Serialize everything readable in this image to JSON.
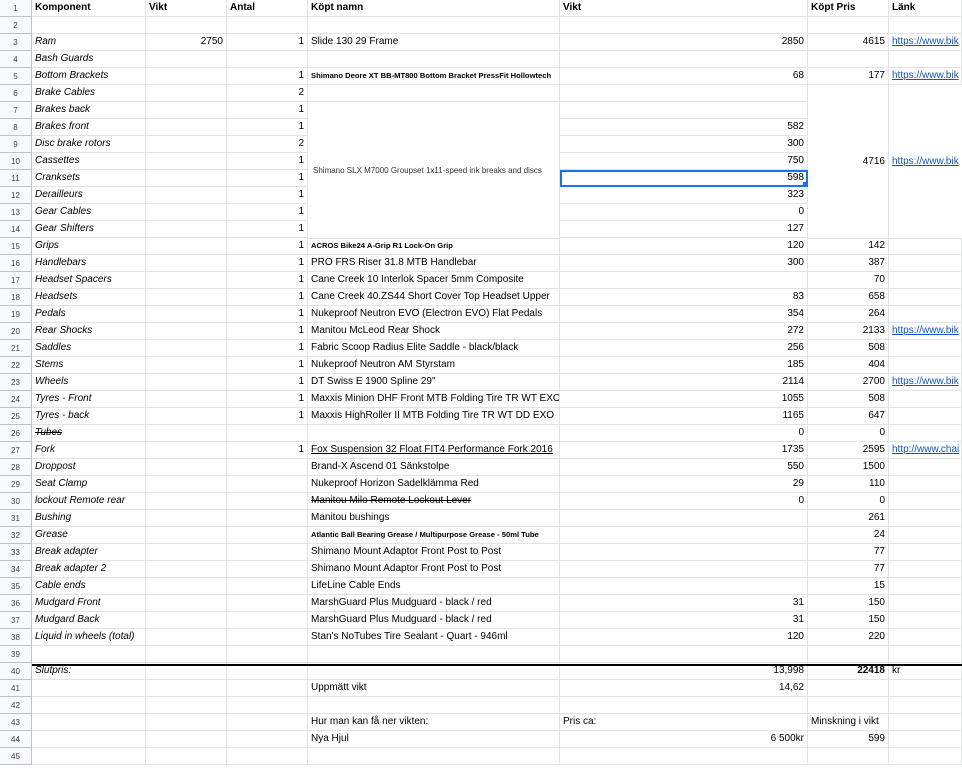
{
  "headers": {
    "komponent": "Komponent",
    "vikt": "Vikt",
    "antal": "Antal",
    "kopt_namn": "Köpt namn",
    "vikt2": "Vikt",
    "kopt_pris": "Köpt Pris",
    "lank": "Länk"
  },
  "row_numbers": [
    "1",
    "2",
    "3",
    "4",
    "5",
    "6",
    "7",
    "8",
    "9",
    "10",
    "11",
    "12",
    "13",
    "14",
    "15",
    "16",
    "17",
    "18",
    "19",
    "20",
    "21",
    "22",
    "23",
    "24",
    "25",
    "26",
    "27",
    "28",
    "29",
    "30",
    "31",
    "32",
    "33",
    "34",
    "35",
    "36",
    "37",
    "38",
    "39",
    "40",
    "41",
    "42",
    "43",
    "44",
    "45"
  ],
  "rows": [
    {
      "a": "Ram",
      "b": "2750",
      "c": "1",
      "d": "Slide 130 29 Frame",
      "e": "2850",
      "f": "4615",
      "g": "https://www.bik"
    },
    {
      "a": "Bash Guards",
      "b": "",
      "c": "",
      "d": "",
      "e": "",
      "f": "",
      "g": ""
    },
    {
      "a": "Bottom Brackets",
      "b": "",
      "c": "1",
      "d": "Shimano Deore XT BB-MT800 Bottom Bracket PressFit Hollowtech",
      "e": "68",
      "f": "177",
      "g": "https://www.bik"
    },
    {
      "a": "Brake Cables",
      "b": "",
      "c": "2",
      "d": "",
      "e": "",
      "f": "",
      "g": ""
    },
    {
      "a": "Brakes back",
      "b": "",
      "c": "1",
      "d": "",
      "e": "",
      "f": "",
      "g": ""
    },
    {
      "a": "Brakes front",
      "b": "",
      "c": "1",
      "d": "",
      "e": "582",
      "f": "",
      "g": ""
    },
    {
      "a": "Disc brake rotors",
      "b": "",
      "c": "2",
      "d": "",
      "e": "300",
      "f": "",
      "g": ""
    },
    {
      "a": "Cassettes",
      "b": "",
      "c": "1",
      "d": "",
      "e": "750",
      "f": "",
      "g": ""
    },
    {
      "a": "Cranksets",
      "b": "",
      "c": "1",
      "d": "",
      "e": "598",
      "f": "",
      "g": ""
    },
    {
      "a": "Derailleurs",
      "b": "",
      "c": "1",
      "d": "",
      "e": "323",
      "f": "",
      "g": ""
    },
    {
      "a": "Gear Cables",
      "b": "",
      "c": "1",
      "d": "",
      "e": "0",
      "f": "",
      "g": ""
    },
    {
      "a": "Gear Shifters",
      "b": "",
      "c": "1",
      "d": "",
      "e": "127",
      "f": "",
      "g": ""
    },
    {
      "a": "Grips",
      "b": "",
      "c": "1",
      "d": "ACROS Bike24 A-Grip R1 Lock-On Grip",
      "e": "120",
      "f": "142",
      "g": ""
    },
    {
      "a": "Handlebars",
      "b": "",
      "c": "1",
      "d": "PRO FRS Riser 31.8 MTB Handlebar",
      "e": "300",
      "f": "387",
      "g": ""
    },
    {
      "a": "Headset Spacers",
      "b": "",
      "c": "1",
      "d": "Cane Creek 10 Interlok Spacer 5mm Composite",
      "e": "",
      "f": "70",
      "g": ""
    },
    {
      "a": "Headsets",
      "b": "",
      "c": "1",
      "d": "Cane Creek 40.ZS44 Short Cover Top Headset Upper",
      "e": "83",
      "f": "658",
      "g": ""
    },
    {
      "a": "Pedals",
      "b": "",
      "c": "1",
      "d": "Nukeproof Neutron EVO (Electron EVO) Flat Pedals",
      "e": "354",
      "f": "264",
      "g": ""
    },
    {
      "a": "Rear Shocks",
      "b": "",
      "c": "1",
      "d": "Manitou McLeod Rear Shock",
      "e": "272",
      "f": "2133",
      "g": "https://www.bik"
    },
    {
      "a": "Saddles",
      "b": "",
      "c": "1",
      "d": "Fabric Scoop Radius Elite Saddle - black/black",
      "e": "256",
      "f": "508",
      "g": ""
    },
    {
      "a": "Stems",
      "b": "",
      "c": "1",
      "d": "Nukeproof Neutron AM Styrstam",
      "e": "185",
      "f": "404",
      "g": ""
    },
    {
      "a": "Wheels",
      "b": "",
      "c": "1",
      "d": "DT Swiss E 1900 Spline 29\"",
      "e": "2114",
      "f": "2700",
      "g": "https://www.bik"
    },
    {
      "a": "Tyres - Front",
      "b": "",
      "c": "1",
      "d": "Maxxis Minion DHF Front MTB Folding Tire TR WT EXO",
      "e": "1055",
      "f": "508",
      "g": ""
    },
    {
      "a": "Tyres - back",
      "b": "",
      "c": "1",
      "d": "Maxxis HighRoller II MTB Folding Tire TR WT DD EXO",
      "e": "1165",
      "f": "647",
      "g": ""
    },
    {
      "a": "Tubes",
      "b": "",
      "c": "",
      "d": "",
      "e": "0",
      "f": "0",
      "g": ""
    },
    {
      "a": "Fork",
      "b": "",
      "c": "1",
      "d": "Fox Suspension 32 Float FIT4 Performance Fork 2016",
      "e": "1735",
      "f": "2595",
      "g": "http://www.chai"
    },
    {
      "a": "Droppost",
      "b": "",
      "c": "",
      "d": "Brand-X Ascend 01 Sänkstolpe",
      "e": "550",
      "f": "1500",
      "g": ""
    },
    {
      "a": "Seat Clamp",
      "b": "",
      "c": "",
      "d": "Nukeproof Horizon Sadelklämma Red",
      "e": "29",
      "f": "110",
      "g": ""
    },
    {
      "a": "lockout Remote rear",
      "b": "",
      "c": "",
      "d": "Manitou Milo Remote Lockout Lever",
      "e": "0",
      "f": "0",
      "g": ""
    },
    {
      "a": "Bushing",
      "b": "",
      "c": "",
      "d": "Manitou bushings",
      "e": "",
      "f": "261",
      "g": ""
    },
    {
      "a": "Grease",
      "b": "",
      "c": "",
      "d": "Atlantic Ball Bearing Grease / Multipurpose Grease - 50ml Tube",
      "e": "",
      "f": "24",
      "g": ""
    },
    {
      "a": "Break adapter",
      "b": "",
      "c": "",
      "d": "Shimano Mount Adaptor Front Post to Post",
      "e": "",
      "f": "77",
      "g": ""
    },
    {
      "a": "Break adapter 2",
      "b": "",
      "c": "",
      "d": "Shimano Mount Adaptor Front Post to Post",
      "e": "",
      "f": "77",
      "g": ""
    },
    {
      "a": "Cable ends",
      "b": "",
      "c": "",
      "d": "LifeLine Cable Ends",
      "e": "",
      "f": "15",
      "g": ""
    },
    {
      "a": "Mudgard Front",
      "b": "",
      "c": "",
      "d": "MarshGuard Plus Mudguard - black / red",
      "e": "31",
      "f": "150",
      "g": ""
    },
    {
      "a": "Mudgard Back",
      "b": "",
      "c": "",
      "d": "MarshGuard Plus Mudguard - black / red",
      "e": "31",
      "f": "150",
      "g": ""
    },
    {
      "a": "Liquid in wheels (total)",
      "b": "",
      "c": "",
      "d": "Stan's NoTubes Tire Sealant - Quart - 946ml",
      "e": "120",
      "f": "220",
      "g": ""
    }
  ],
  "merged": {
    "groupset_name": "Shimano SLX M7000 Groupset 1x11-speed ink breaks and discs",
    "groupset_price": "4716",
    "groupset_link": "https://www.bik"
  },
  "summary": {
    "slutpris_label": "Slutpris:",
    "total_weight": "13,998",
    "total_price": "22418",
    "currency": "kr",
    "measured_label": "Uppmätt vikt",
    "measured_value": "14,62",
    "hur_label": "Hur man kan få ner vikten:",
    "pris_ca_label": "Pris ca:",
    "minskning_label": "Minskning i vikt",
    "nya_hjul_label": "Nya Hjul",
    "nya_hjul_price": "6 500kr",
    "nya_hjul_reduction": "599"
  },
  "colors": {
    "link": "#1155cc",
    "selection": "#1a73e8",
    "header_bg": "#f8f9fa",
    "grid": "#e2e3e3"
  }
}
